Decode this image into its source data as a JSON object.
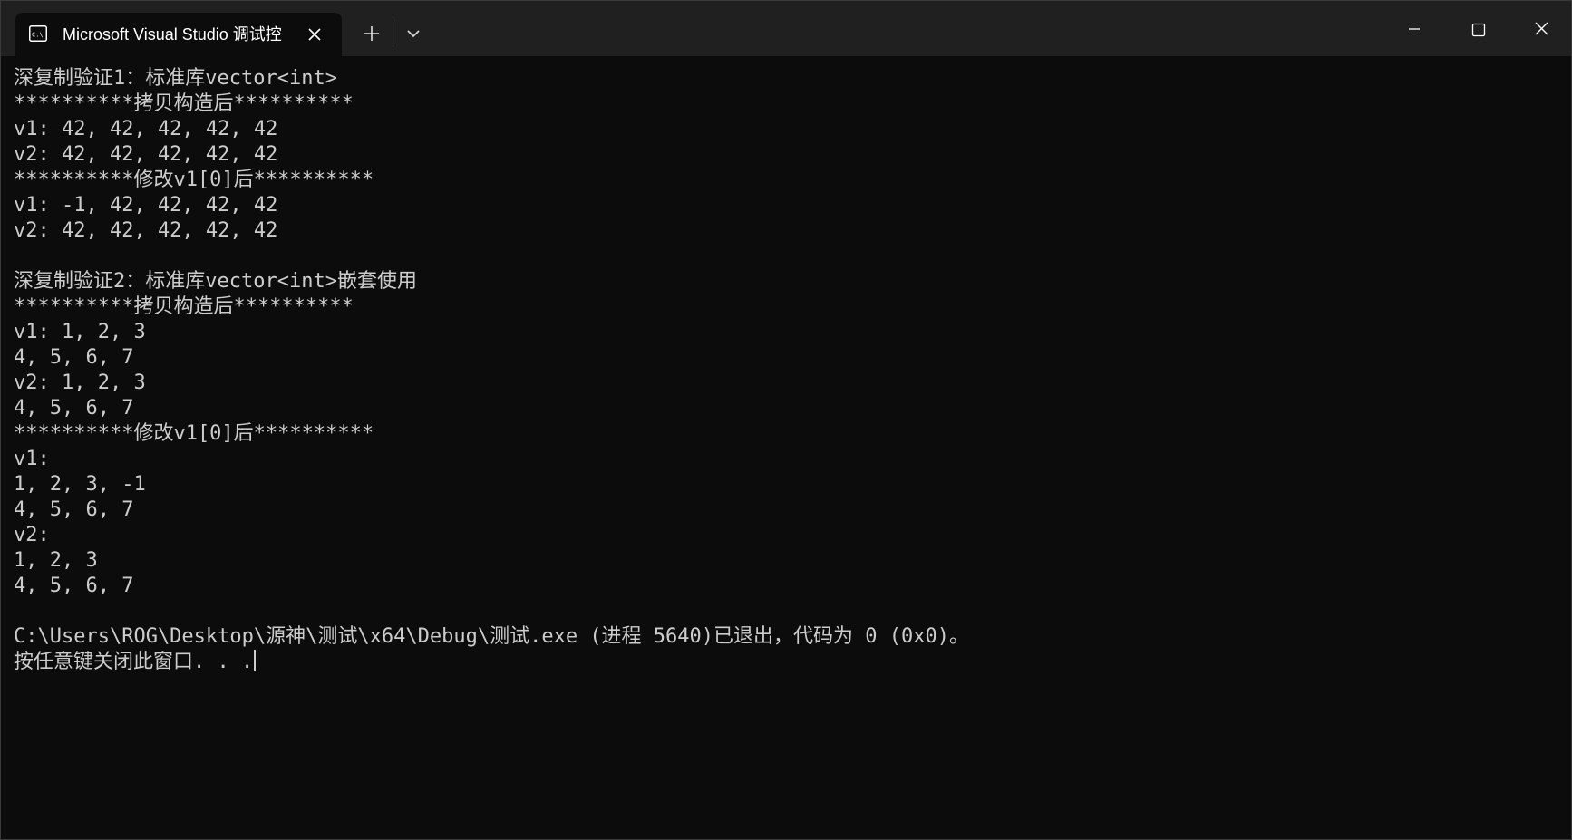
{
  "tab": {
    "title": "Microsoft Visual Studio 调试控",
    "icon": "console-app-icon"
  },
  "titlebar_controls": {
    "new_tab_icon": "plus-icon",
    "dropdown_icon": "chevron-down-icon",
    "minimize_icon": "minimize-icon",
    "maximize_icon": "maximize-icon",
    "close_icon": "close-icon"
  },
  "console": {
    "lines": [
      "深复制验证1：标准库vector<int>",
      "**********拷贝构造后**********",
      "v1: 42, 42, 42, 42, 42",
      "v2: 42, 42, 42, 42, 42",
      "**********修改v1[0]后**********",
      "v1: -1, 42, 42, 42, 42",
      "v2: 42, 42, 42, 42, 42",
      "",
      "深复制验证2：标准库vector<int>嵌套使用",
      "**********拷贝构造后**********",
      "v1: 1, 2, 3",
      "4, 5, 6, 7",
      "v2: 1, 2, 3",
      "4, 5, 6, 7",
      "**********修改v1[0]后**********",
      "v1:",
      "1, 2, 3, -1",
      "4, 5, 6, 7",
      "v2:",
      "1, 2, 3",
      "4, 5, 6, 7",
      "",
      "C:\\Users\\ROG\\Desktop\\源神\\测试\\x64\\Debug\\测试.exe (进程 5640)已退出，代码为 0 (0x0)。",
      "按任意键关闭此窗口. . ."
    ]
  },
  "colors": {
    "console_bg": "#0c0c0c",
    "console_text": "#cccccc",
    "titlebar_bg": "#202020"
  }
}
